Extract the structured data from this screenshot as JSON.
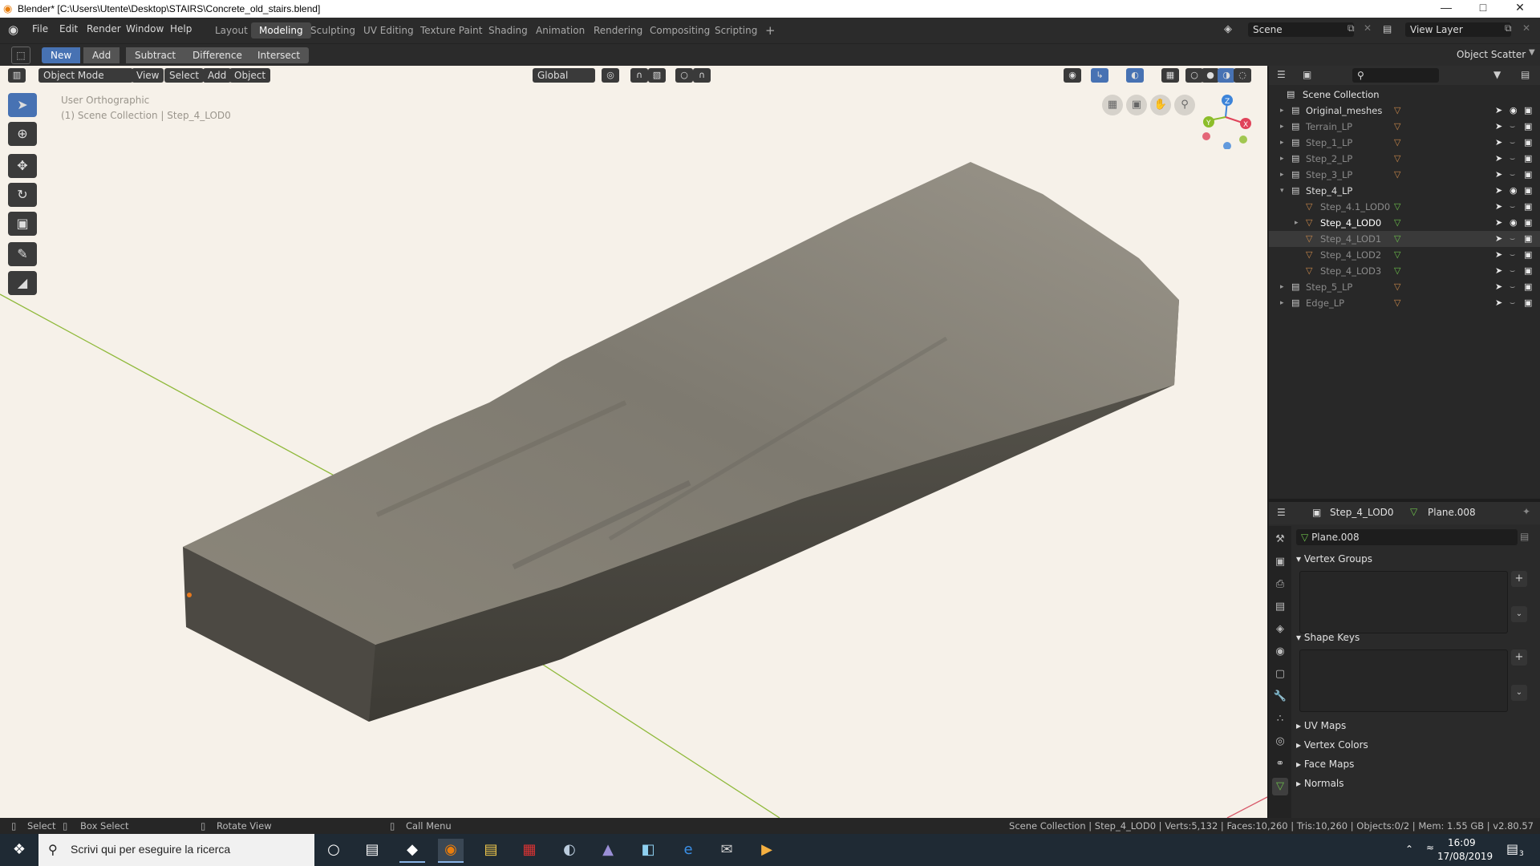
{
  "window": {
    "title": "Blender* [C:\\Users\\Utente\\Desktop\\STAIRS\\Concrete_old_stairs.blend]",
    "controls": [
      "—",
      "□",
      "✕"
    ]
  },
  "menu": {
    "items": [
      "File",
      "Edit",
      "Render",
      "Window",
      "Help"
    ],
    "workspaces": [
      "Layout",
      "Modeling",
      "Sculpting",
      "UV Editing",
      "Texture Paint",
      "Shading",
      "Animation",
      "Rendering",
      "Compositing",
      "Scripting"
    ],
    "active_workspace": "Modeling",
    "add_tab": "+",
    "scene": "Scene",
    "view_layer": "View Layer"
  },
  "toolsettings": {
    "modes": [
      "New",
      "Add",
      "Subtract",
      "Difference",
      "Intersect"
    ],
    "active_mode": "New",
    "right_label": "Object Scatter"
  },
  "viewport": {
    "object_mode": "Object Mode",
    "menus": [
      "View",
      "Select",
      "Add",
      "Object"
    ],
    "orientation": "Global",
    "view_name": "User Orthographic",
    "collection_info": "(1) Scene Collection | Step_4_LOD0",
    "gizmo_axes": [
      "X",
      "Y",
      "Z"
    ]
  },
  "outliner": {
    "root": "Scene Collection",
    "rows": [
      {
        "name": "Original_meshes",
        "level": 1,
        "expand": "▸",
        "icon": "collection-icon",
        "sub": "▽",
        "eye": true
      },
      {
        "name": "Terrain_LP",
        "level": 1,
        "expand": "▸",
        "icon": "collection-icon",
        "sub": "▽",
        "eye": false,
        "dim": true
      },
      {
        "name": "Step_1_LP",
        "level": 1,
        "expand": "▸",
        "icon": "collection-icon",
        "sub": "▽",
        "eye": false,
        "dim": true
      },
      {
        "name": "Step_2_LP",
        "level": 1,
        "expand": "▸",
        "icon": "collection-icon",
        "sub": "▽",
        "eye": false,
        "dim": true
      },
      {
        "name": "Step_3_LP",
        "level": 1,
        "expand": "▸",
        "icon": "collection-icon",
        "sub": "▽",
        "eye": false,
        "dim": true
      },
      {
        "name": "Step_4_LP",
        "level": 1,
        "expand": "▾",
        "icon": "collection-icon",
        "sub": "",
        "eye": true
      },
      {
        "name": "Step_4.1_LOD0",
        "level": 2,
        "expand": "",
        "icon": "mesh-icon",
        "sub": "▽",
        "eye": false,
        "dim": true
      },
      {
        "name": "Step_4_LOD0",
        "level": 2,
        "expand": "▸",
        "icon": "mesh-icon",
        "sub": "▽",
        "eye": true,
        "active": true
      },
      {
        "name": "Step_4_LOD1",
        "level": 2,
        "expand": "",
        "icon": "mesh-icon",
        "sub": "▽",
        "eye": false,
        "dim": true,
        "selected": true
      },
      {
        "name": "Step_4_LOD2",
        "level": 2,
        "expand": "",
        "icon": "mesh-icon",
        "sub": "▽",
        "eye": false,
        "dim": true
      },
      {
        "name": "Step_4_LOD3",
        "level": 2,
        "expand": "",
        "icon": "mesh-icon",
        "sub": "▽",
        "eye": false,
        "dim": true
      },
      {
        "name": "Step_5_LP",
        "level": 1,
        "expand": "▸",
        "icon": "collection-icon",
        "sub": "▽",
        "eye": false,
        "dim": true
      },
      {
        "name": "Edge_LP",
        "level": 1,
        "expand": "▸",
        "icon": "collection-icon",
        "sub": "▽",
        "eye": false,
        "dim": true
      }
    ]
  },
  "properties": {
    "object_name": "Step_4_LOD0",
    "mesh_name": "Plane.008",
    "datablock": "Plane.008",
    "panels": [
      "Vertex Groups",
      "Shape Keys",
      "UV Maps",
      "Vertex Colors",
      "Face Maps",
      "Normals"
    ]
  },
  "statusbar": {
    "select": "Select",
    "box_select": "Box Select",
    "rotate": "Rotate View",
    "call_menu": "Call Menu",
    "stats": "Scene Collection | Step_4_LOD0 | Verts:5,132 | Faces:10,260 | Tris:10,260 | Objects:0/2 | Mem: 1.55 GB | v2.80.57"
  },
  "taskbar": {
    "search_placeholder": "Scrivi qui per eseguire la ricerca",
    "time": "16:09",
    "date": "17/08/2019",
    "notification_count": "3"
  },
  "colors": {
    "accent": "#4772b3",
    "viewport_bg": "#f6f1e9",
    "axis_x": "#e0435a",
    "axis_y": "#8cbd2a",
    "axis_z": "#3d84d9",
    "mesh_icon": "#c7874a",
    "data_icon": "#6dbf4b"
  }
}
